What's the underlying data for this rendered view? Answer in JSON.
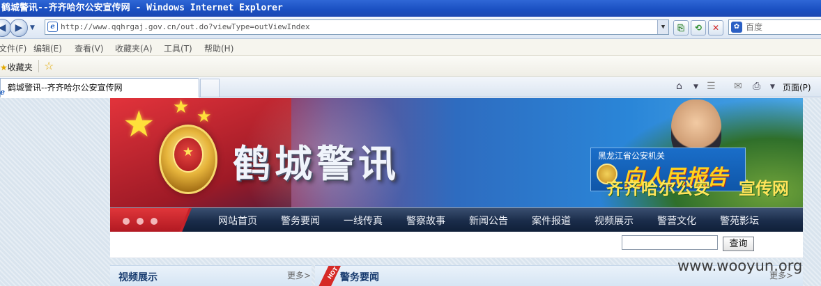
{
  "window": {
    "title": "鹤城警讯--齐齐哈尔公安宣传网 - Windows Internet Explorer"
  },
  "address_bar": {
    "url": "http://www.qqhrgaj.gov.cn/out.do?viewType=outViewIndex",
    "search_placeholder": "百度"
  },
  "menu": [
    "文件(F)",
    "编辑(E)",
    "查看(V)",
    "收藏夹(A)",
    "工具(T)",
    "帮助(H)"
  ],
  "favorites_bar": {
    "label": "收藏夹"
  },
  "tab": {
    "title": "鹤城警讯--齐齐哈尔公安宣传网"
  },
  "toolbar": {
    "page_label": "页面(P)"
  },
  "banner": {
    "brand": "鹤城警讯",
    "campaign_small": "黑龙江省公安机关",
    "campaign_big": "向人民报告",
    "campaign_tail": "齐齐哈尔公安",
    "campaign_tail_bold": "宣传网"
  },
  "nav": [
    "网站首页",
    "警务要闻",
    "一线传真",
    "警察故事",
    "新闻公告",
    "案件报道",
    "视频展示",
    "警营文化",
    "警苑影坛"
  ],
  "site_search": {
    "button": "查询",
    "value": ""
  },
  "panels": {
    "left": {
      "title": "视频展示",
      "more": "更多>"
    },
    "right": {
      "badge": "HOT",
      "title": "警务要闻",
      "more": "更多>"
    }
  },
  "watermark": "www.wooyun.org",
  "colors": {
    "title_bar": "#1a4fc1",
    "nav_bar": "#1a2c4a",
    "nav_accent_red": "#c52129",
    "panel_title": "#163a6e",
    "page_background": "#d9e4ee"
  }
}
